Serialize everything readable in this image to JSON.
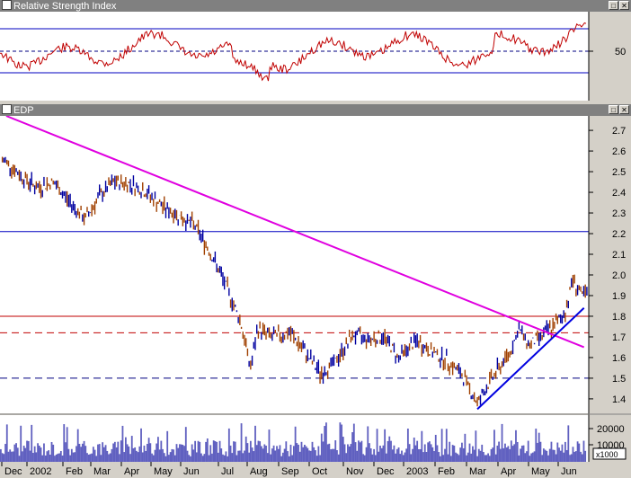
{
  "rsi_panel": {
    "title": "Relative Strength Index",
    "tick_label": "50",
    "levels": [
      70,
      50,
      30
    ]
  },
  "price_panel": {
    "title": "EDP",
    "y_ticks": [
      "2.7",
      "2.6",
      "2.5",
      "2.4",
      "2.3",
      "2.2",
      "2.1",
      "2.0",
      "1.9",
      "1.8",
      "1.7",
      "1.6",
      "1.5",
      "1.4"
    ],
    "hlines": [
      {
        "value": 2.21,
        "color": "#0000c0",
        "style": "solid"
      },
      {
        "value": 1.8,
        "color": "#c00000",
        "style": "solid"
      },
      {
        "value": 1.72,
        "color": "#c00000",
        "style": "dashed"
      },
      {
        "value": 1.5,
        "color": "#000080",
        "style": "dashed"
      }
    ]
  },
  "volume_panel": {
    "y_ticks": [
      "20000",
      "10000"
    ],
    "unit": "x1000"
  },
  "x_axis": {
    "labels": [
      "Dec",
      "2002",
      "Feb",
      "Mar",
      "Apr",
      "May",
      "Jun",
      "Jul",
      "Aug",
      "Sep",
      "Oct",
      "Nov",
      "Dec",
      "2003",
      "Feb",
      "Mar",
      "Apr",
      "May",
      "Jun"
    ]
  },
  "chart_data": {
    "type": "line",
    "title": "EDP",
    "series": [
      {
        "name": "EDP",
        "points": [
          [
            "2001-12-01",
            2.55
          ],
          [
            "2001-12-15",
            2.48
          ],
          [
            "2002-01-01",
            2.42
          ],
          [
            "2002-01-15",
            2.45
          ],
          [
            "2002-02-01",
            2.35
          ],
          [
            "2002-02-15",
            2.27
          ],
          [
            "2002-03-01",
            2.38
          ],
          [
            "2002-03-15",
            2.45
          ],
          [
            "2002-04-01",
            2.44
          ],
          [
            "2002-04-15",
            2.4
          ],
          [
            "2002-05-01",
            2.33
          ],
          [
            "2002-05-15",
            2.29
          ],
          [
            "2002-06-01",
            2.24
          ],
          [
            "2002-06-15",
            2.12
          ],
          [
            "2002-07-01",
            1.95
          ],
          [
            "2002-07-15",
            1.78
          ],
          [
            "2002-07-25",
            1.55
          ],
          [
            "2002-08-01",
            1.74
          ],
          [
            "2002-08-15",
            1.7
          ],
          [
            "2002-09-01",
            1.72
          ],
          [
            "2002-09-15",
            1.63
          ],
          [
            "2002-10-01",
            1.52
          ],
          [
            "2002-10-15",
            1.58
          ],
          [
            "2002-11-01",
            1.71
          ],
          [
            "2002-11-15",
            1.69
          ],
          [
            "2002-12-01",
            1.7
          ],
          [
            "2002-12-15",
            1.6
          ],
          [
            "2003-01-01",
            1.68
          ],
          [
            "2003-01-15",
            1.63
          ],
          [
            "2003-02-01",
            1.58
          ],
          [
            "2003-02-15",
            1.51
          ],
          [
            "2003-03-01",
            1.38
          ],
          [
            "2003-03-15",
            1.5
          ],
          [
            "2003-04-01",
            1.62
          ],
          [
            "2003-04-10",
            1.74
          ],
          [
            "2003-04-20",
            1.66
          ],
          [
            "2003-05-01",
            1.7
          ],
          [
            "2003-05-15",
            1.76
          ],
          [
            "2003-05-25",
            1.82
          ],
          [
            "2003-06-01",
            1.98
          ],
          [
            "2003-06-10",
            1.9
          ]
        ]
      }
    ],
    "trendlines": [
      {
        "from": [
          "2001-12-01",
          2.77
        ],
        "to": [
          "2003-06-12",
          1.65
        ],
        "color": "#e000e0"
      },
      {
        "from": [
          "2003-03-01",
          1.35
        ],
        "to": [
          "2003-06-12",
          1.84
        ],
        "color": "#0000e0"
      }
    ],
    "y_range": [
      1.33,
      2.77
    ]
  }
}
